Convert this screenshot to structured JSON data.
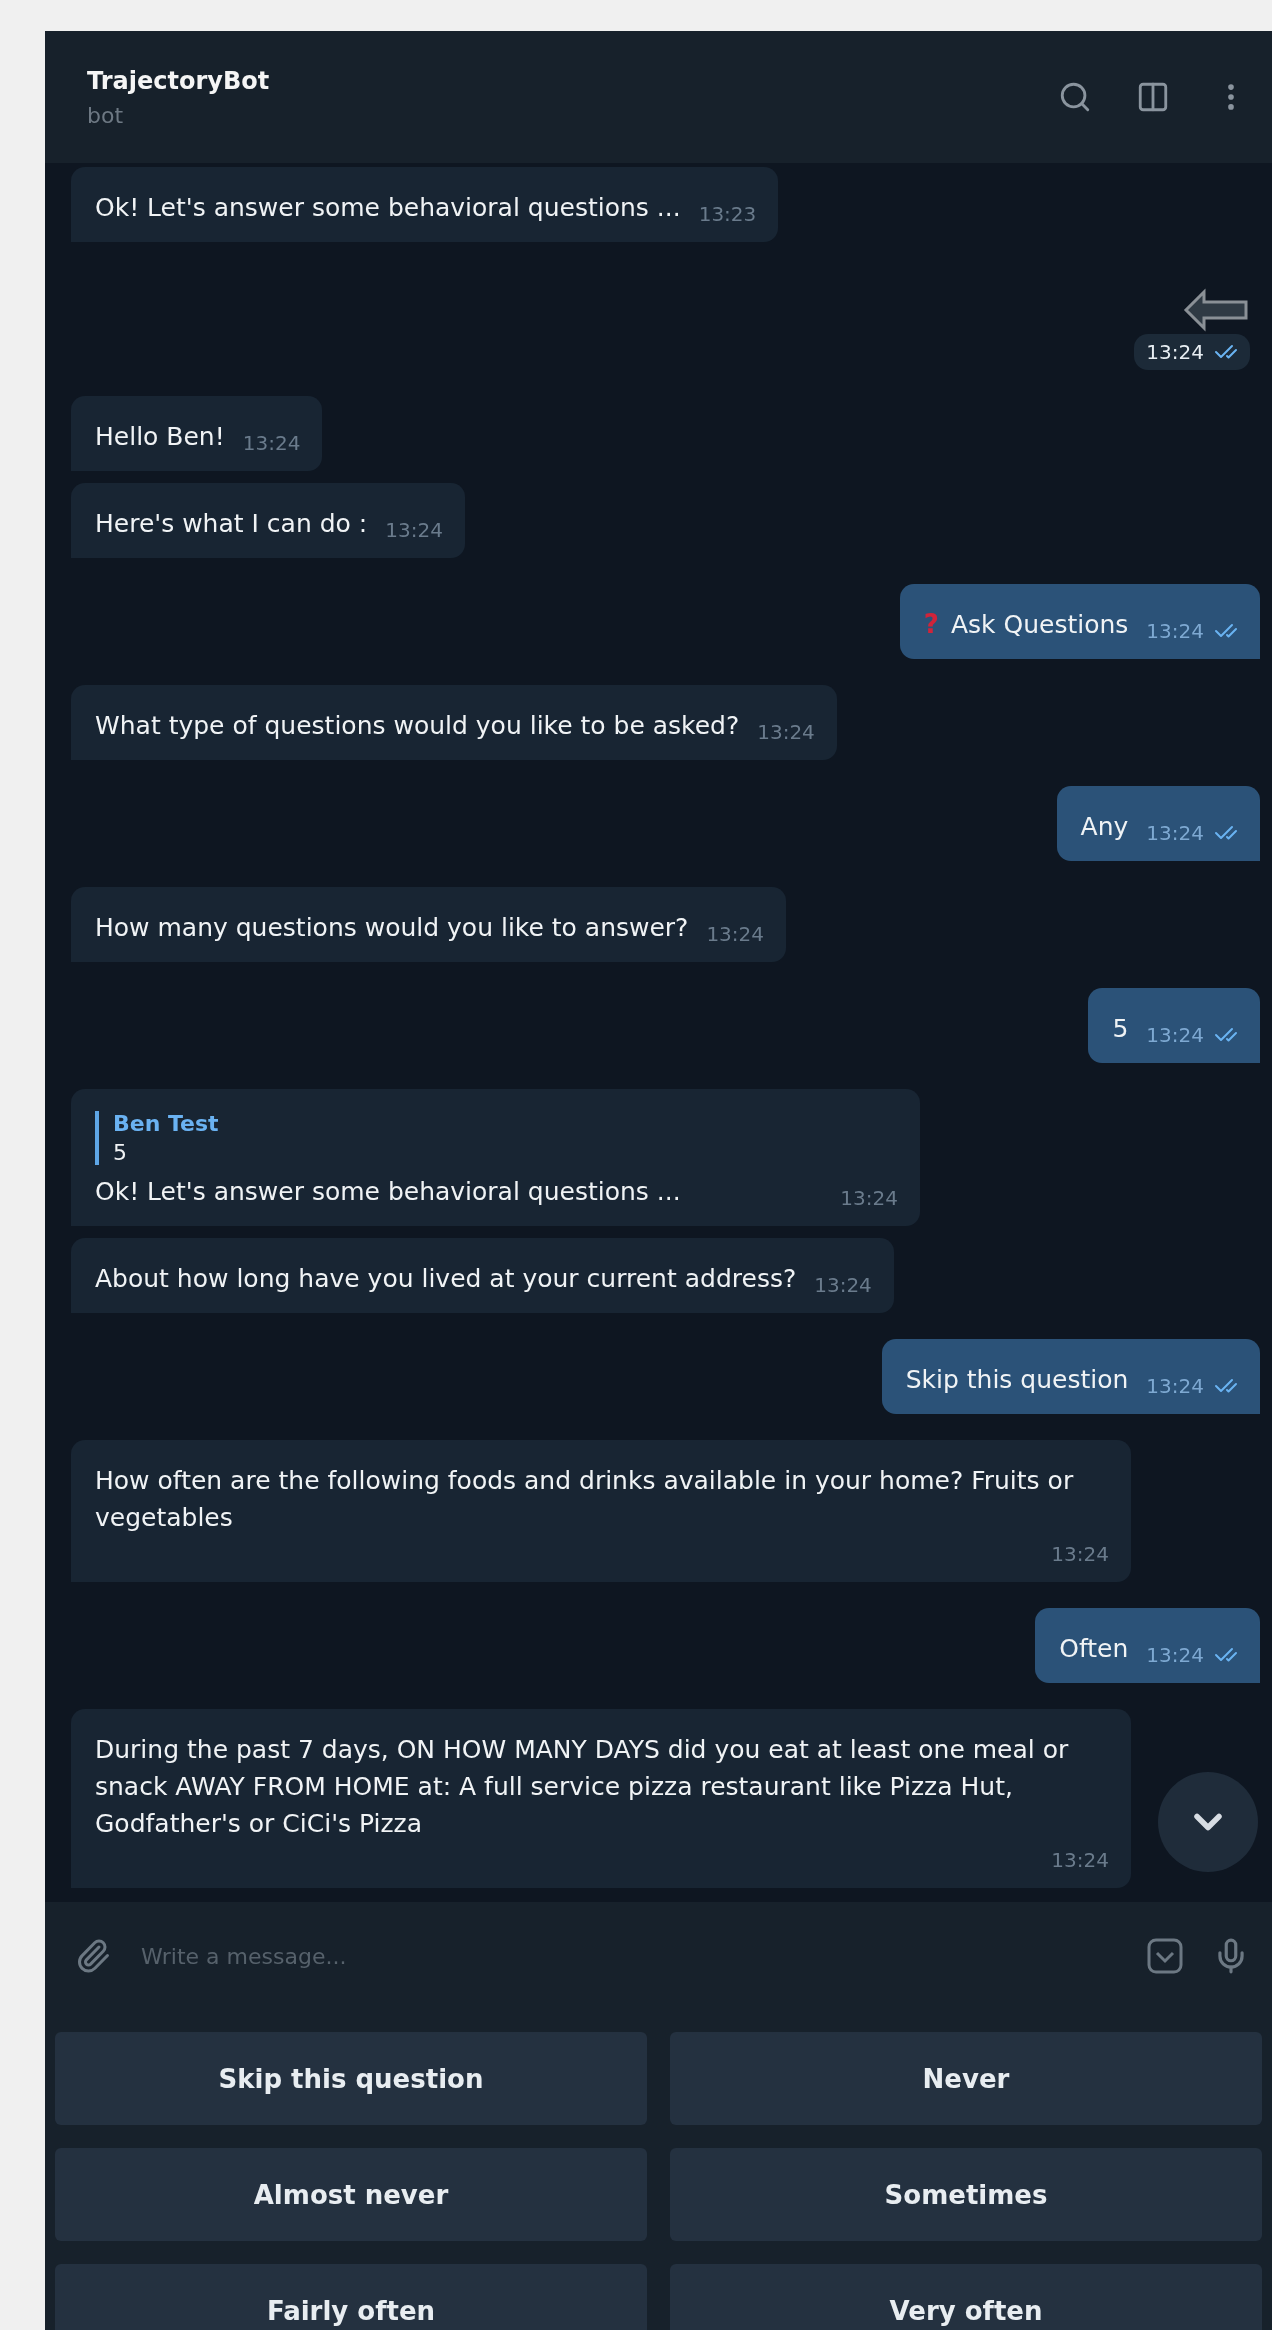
{
  "header": {
    "title": "TrajectoryBot",
    "subtitle": "bot"
  },
  "messages": [
    {
      "kind": "text",
      "outgoing": false,
      "text": "Ok! Let's answer some behavioral questions ...",
      "time": "13:23"
    },
    {
      "kind": "sticker",
      "outgoing": true,
      "time": "13:24",
      "read": true
    },
    {
      "kind": "text",
      "outgoing": false,
      "text": "Hello Ben!",
      "time": "13:24"
    },
    {
      "kind": "text",
      "outgoing": false,
      "text": "Here's what I can do :",
      "time": "13:24"
    },
    {
      "kind": "text",
      "outgoing": true,
      "emoji": "?",
      "text": "Ask Questions",
      "time": "13:24",
      "read": true
    },
    {
      "kind": "text",
      "outgoing": false,
      "text": "What type of questions would you like to be asked?",
      "time": "13:24"
    },
    {
      "kind": "text",
      "outgoing": true,
      "text": "Any",
      "time": "13:24",
      "read": true
    },
    {
      "kind": "text",
      "outgoing": false,
      "text": "How many questions would you like to answer?",
      "time": "13:24"
    },
    {
      "kind": "text",
      "outgoing": true,
      "text": "5",
      "time": "13:24",
      "read": true
    },
    {
      "kind": "reply",
      "outgoing": false,
      "reply_name": "Ben Test",
      "reply_text": "5",
      "text": "Ok! Let's answer some behavioral questions ...",
      "time": "13:24"
    },
    {
      "kind": "text",
      "outgoing": false,
      "text": "About how long have you lived at your current address?",
      "time": "13:24"
    },
    {
      "kind": "text",
      "outgoing": true,
      "text": "Skip this question",
      "time": "13:24",
      "read": true
    },
    {
      "kind": "text",
      "outgoing": false,
      "text": "How often are the following foods and drinks available in your home?  Fruits or vegetables",
      "time": "13:24"
    },
    {
      "kind": "text",
      "outgoing": true,
      "text": "Often",
      "time": "13:24",
      "read": true
    },
    {
      "kind": "text",
      "outgoing": false,
      "text": "During the past 7 days, ON HOW MANY DAYS did you eat at least one meal or snack AWAY FROM HOME at:  A full service pizza restaurant like Pizza Hut, Godfather's or CiCi's Pizza",
      "time": "13:24"
    }
  ],
  "composer": {
    "placeholder": "Write a message..."
  },
  "keyboard": [
    [
      "Skip this question",
      "Never"
    ],
    [
      "Almost never",
      "Sometimes"
    ],
    [
      "Fairly often",
      "Very often"
    ]
  ]
}
